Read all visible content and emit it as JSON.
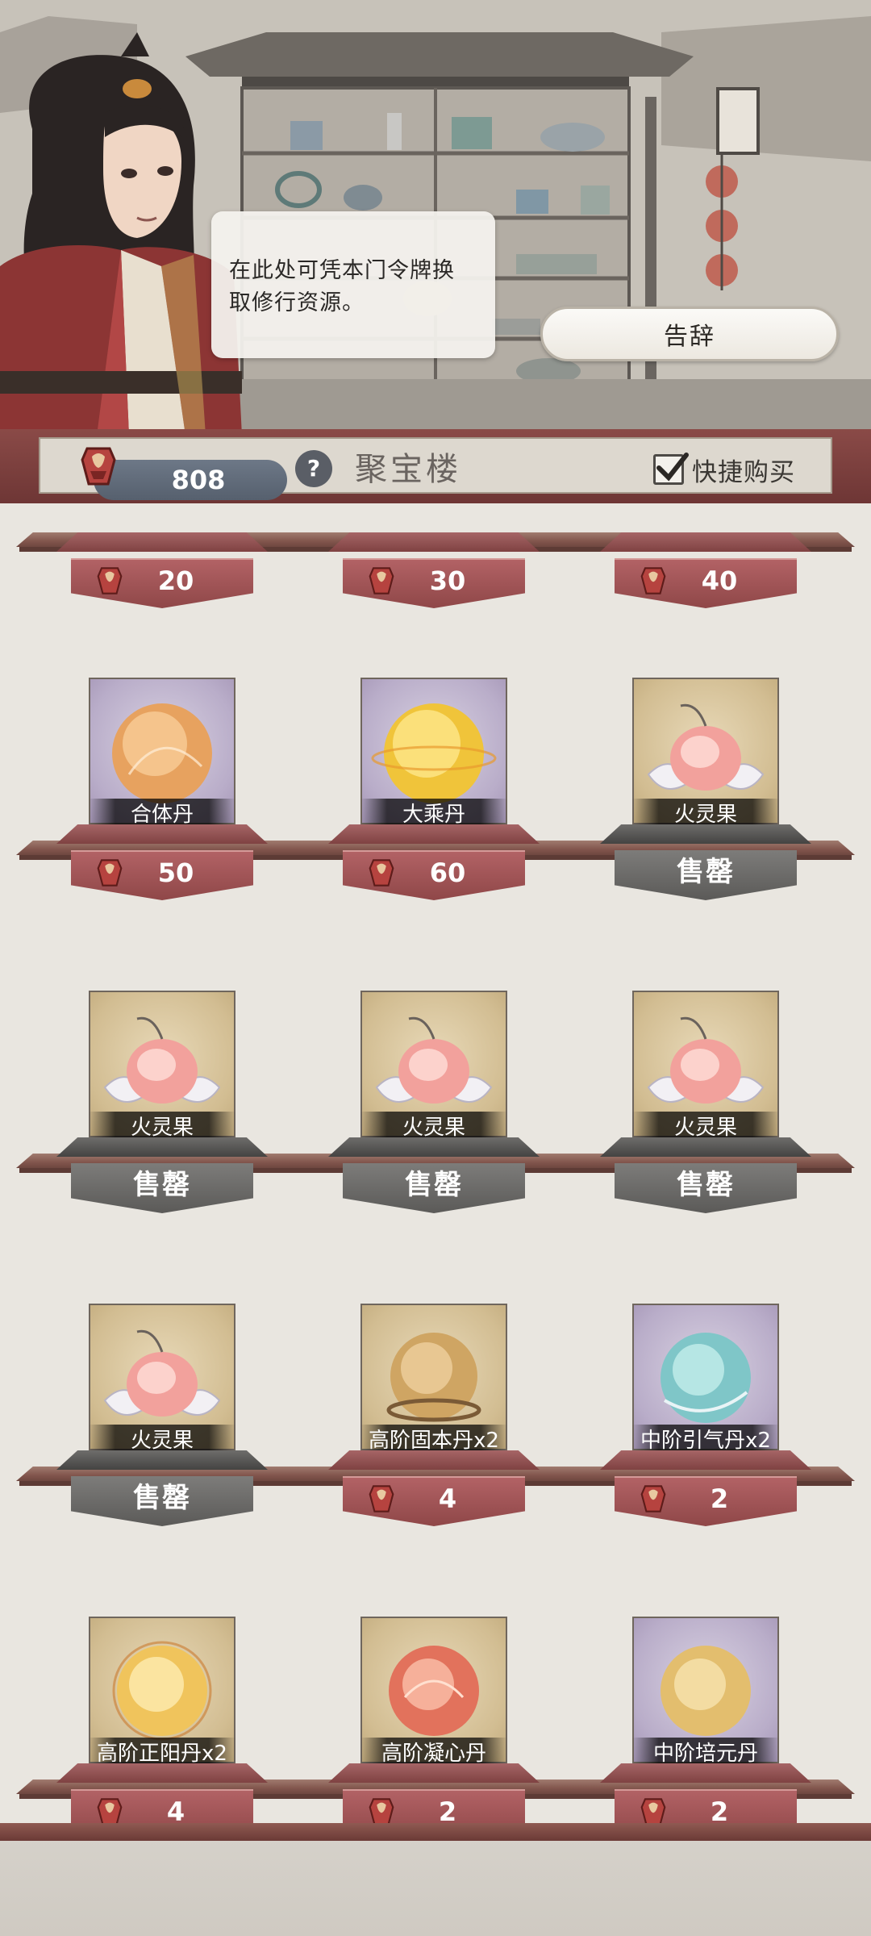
{
  "dialog": {
    "text_line1": "在此处可凭本门令牌换",
    "text_line2": "取修行资源。",
    "farewell_button": "告辞"
  },
  "header": {
    "currency_amount": "808",
    "help_label": "?",
    "shop_title": "聚宝楼",
    "quick_buy_label": "快捷购买",
    "quick_buy_checked": true
  },
  "shelves": {
    "row0": {
      "items": [
        {
          "price": "20"
        },
        {
          "price": "30"
        },
        {
          "price": "40"
        }
      ]
    },
    "row1": {
      "items": [
        {
          "name": "合体丹",
          "price": "50",
          "frame": "purple",
          "icon": "orange-orb"
        },
        {
          "name": "大乘丹",
          "price": "60",
          "frame": "purple",
          "icon": "gold-orb"
        },
        {
          "name": "火灵果",
          "sold_out": "售罄",
          "frame": "gold",
          "icon": "fire-spirit-fruit"
        }
      ]
    },
    "row2": {
      "items": [
        {
          "name": "火灵果",
          "sold_out": "售罄",
          "frame": "gold",
          "icon": "fire-spirit-fruit"
        },
        {
          "name": "火灵果",
          "sold_out": "售罄",
          "frame": "gold",
          "icon": "fire-spirit-fruit"
        },
        {
          "name": "火灵果",
          "sold_out": "售罄",
          "frame": "gold",
          "icon": "fire-spirit-fruit"
        }
      ]
    },
    "row3": {
      "items": [
        {
          "name": "火灵果",
          "sold_out": "售罄",
          "frame": "gold",
          "icon": "fire-spirit-fruit"
        },
        {
          "name": "高阶固本丹x2",
          "price": "4",
          "frame": "gold",
          "icon": "bronze-orb"
        },
        {
          "name": "中阶引气丹x2",
          "price": "2",
          "frame": "purple",
          "icon": "cyan-orb"
        }
      ]
    },
    "row4": {
      "items": [
        {
          "name": "高阶正阳丹x2",
          "price": "4",
          "frame": "gold",
          "icon": "sun-orb"
        },
        {
          "name": "高阶凝心丹",
          "price": "2",
          "frame": "gold",
          "icon": "red-orb"
        },
        {
          "name": "中阶培元丹",
          "price": "2",
          "frame": "purple",
          "icon": "amber-orb"
        }
      ]
    }
  },
  "colors": {
    "price_tag": "#a0575a",
    "sold_out_tag": "#6b6a68",
    "shelf": "#82564d",
    "header_bar": "#7a403e"
  }
}
